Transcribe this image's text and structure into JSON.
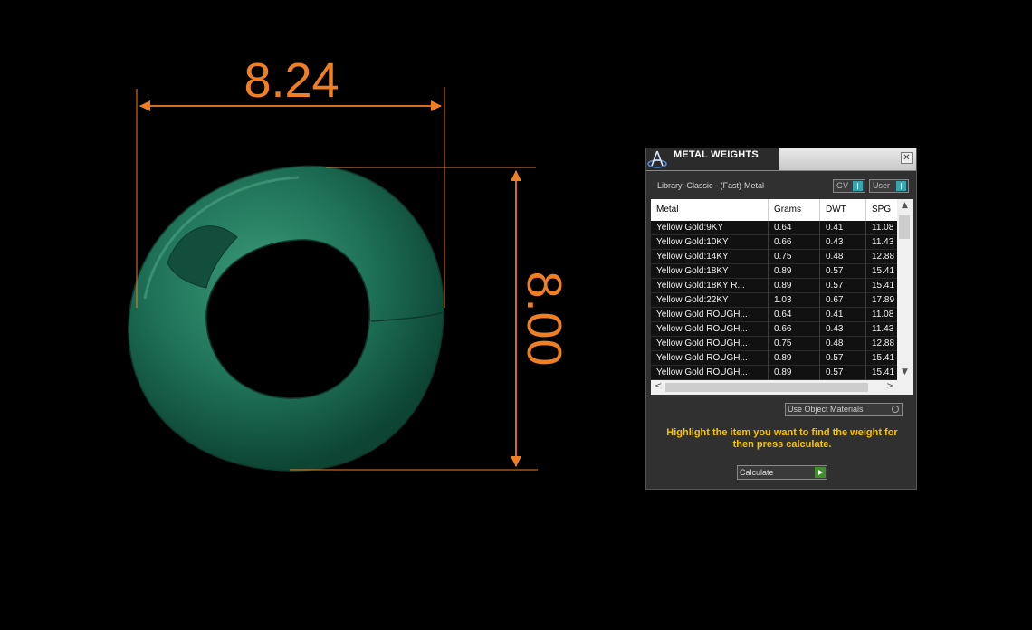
{
  "viewport": {
    "width_dimension": "8.24",
    "height_dimension": "8.00",
    "dimension_color": "#f07f24",
    "ring_color": "#1f6e55"
  },
  "panel": {
    "title": "METAL WEIGHTS",
    "close_label": "✕",
    "library_label": "Library: Classic - (Fast)-Metal",
    "toggles": {
      "gv": "GV",
      "user": "User"
    },
    "columns": [
      "Metal",
      "Grams",
      "DWT",
      "SPG"
    ],
    "rows": [
      [
        "Yellow Gold:9KY",
        "0.64",
        "0.41",
        "11.08"
      ],
      [
        "Yellow Gold:10KY",
        "0.66",
        "0.43",
        "11.43"
      ],
      [
        "Yellow Gold:14KY",
        "0.75",
        "0.48",
        "12.88"
      ],
      [
        "Yellow Gold:18KY",
        "0.89",
        "0.57",
        "15.41"
      ],
      [
        "Yellow Gold:18KY R...",
        "0.89",
        "0.57",
        "15.41"
      ],
      [
        "Yellow Gold:22KY",
        "1.03",
        "0.67",
        "17.89"
      ],
      [
        "Yellow Gold ROUGH...",
        "0.64",
        "0.41",
        "11.08"
      ],
      [
        "Yellow Gold ROUGH...",
        "0.66",
        "0.43",
        "11.43"
      ],
      [
        "Yellow Gold ROUGH...",
        "0.75",
        "0.48",
        "12.88"
      ],
      [
        "Yellow Gold ROUGH...",
        "0.89",
        "0.57",
        "15.41"
      ],
      [
        "Yellow Gold ROUGH...",
        "0.89",
        "0.57",
        "15.41"
      ]
    ],
    "use_object_materials": "Use Object Materials",
    "hint": "Highlight the item you want to find the weight for then press calculate.",
    "calculate_label": "Calculate",
    "accent_color": "#f5c400"
  }
}
